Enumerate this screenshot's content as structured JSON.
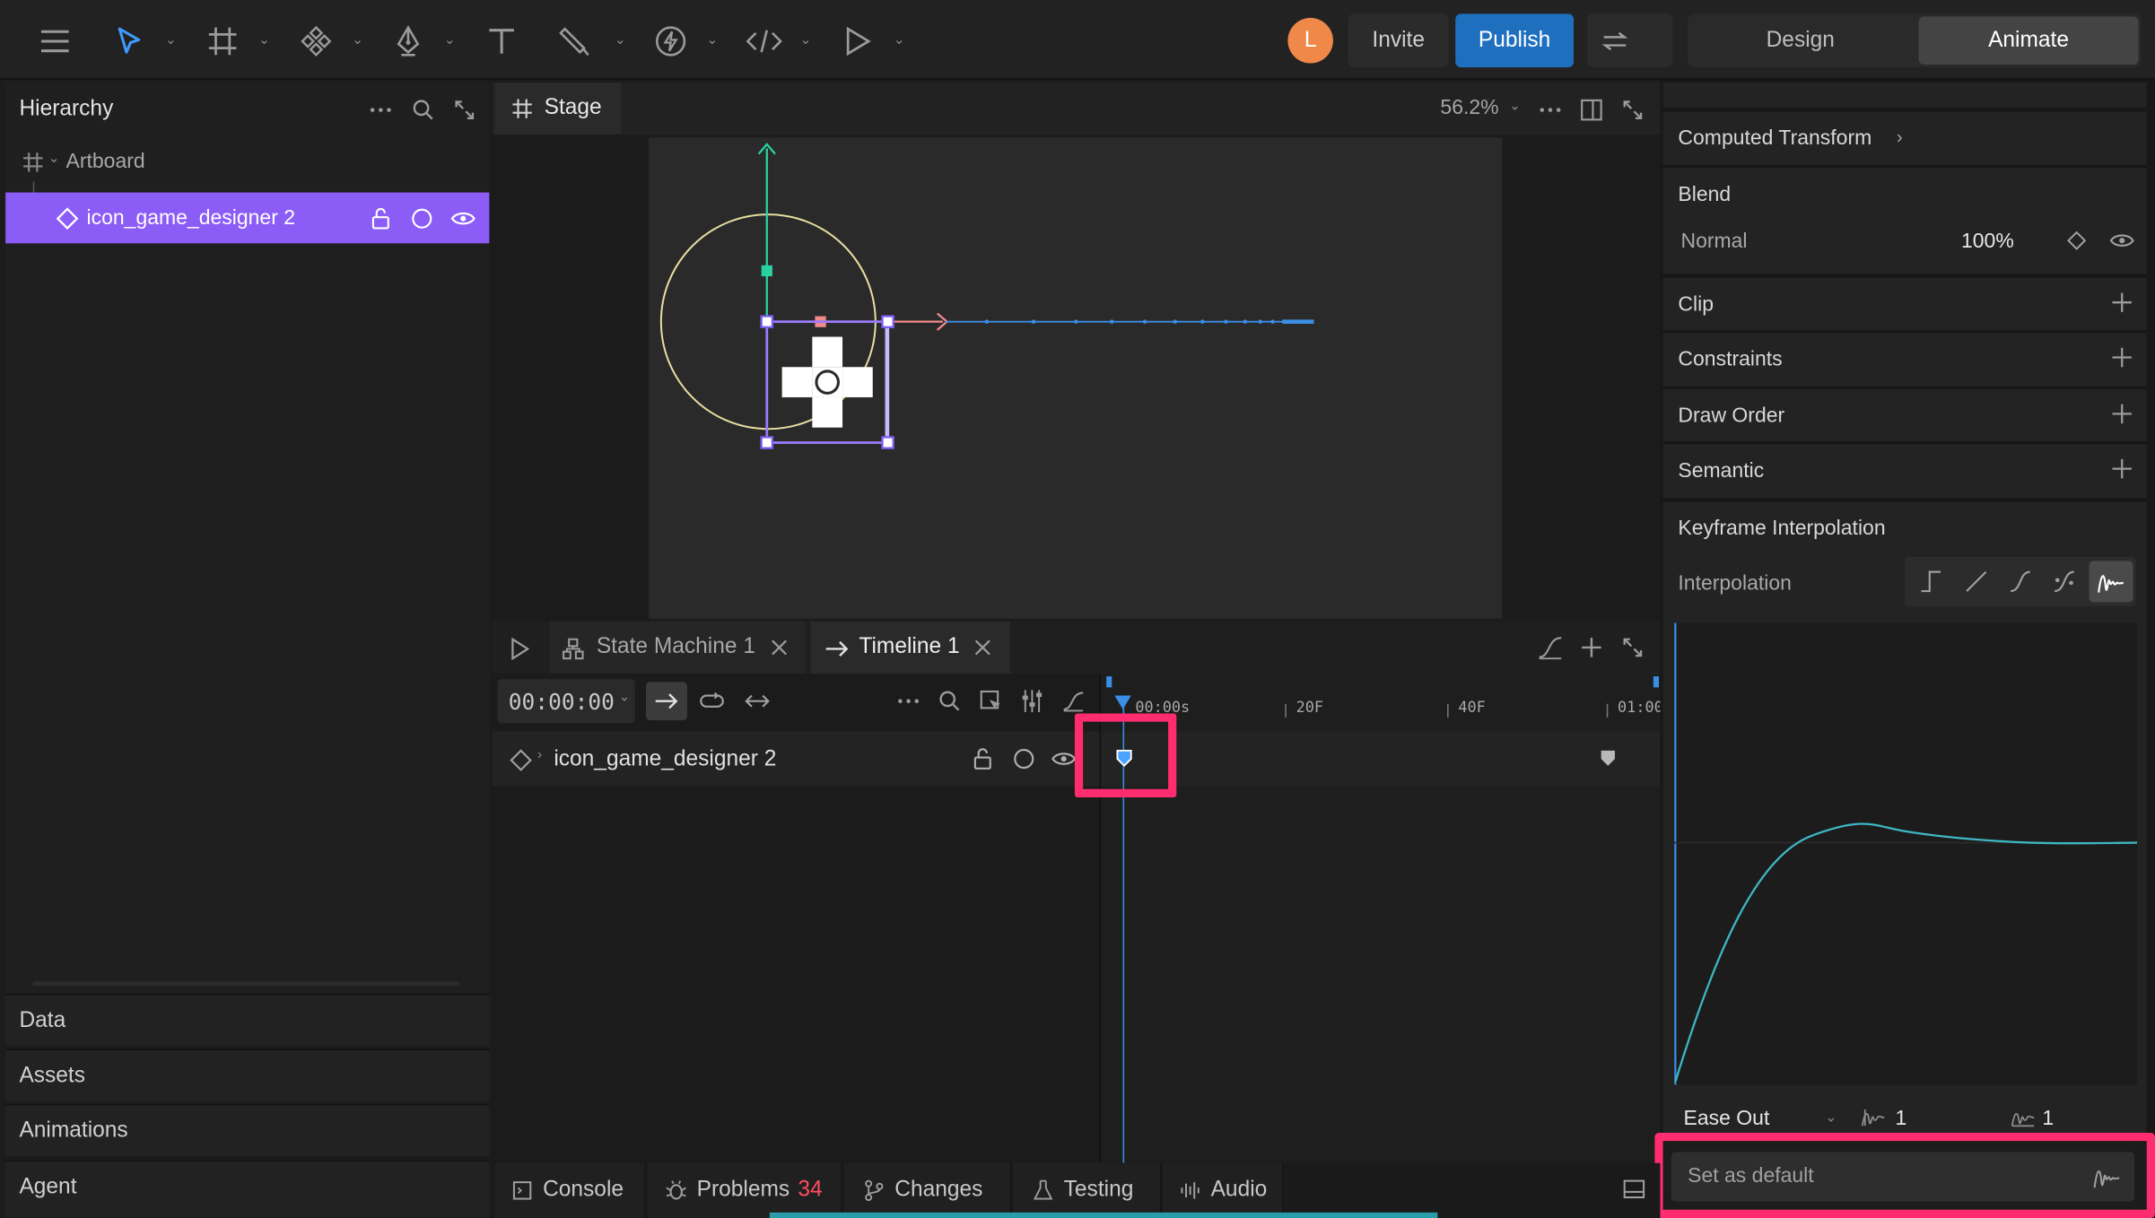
{
  "toolbar": {
    "avatar_initial": "L",
    "invite_label": "Invite",
    "publish_label": "Publish",
    "mode_design": "Design",
    "mode_animate": "Animate"
  },
  "hierarchy": {
    "title": "Hierarchy",
    "artboard_label": "Artboard",
    "selected_item": "icon_game_designer 2"
  },
  "left_sections": [
    "Data",
    "Assets",
    "Animations",
    "Agent"
  ],
  "stage": {
    "tab_label": "Stage",
    "zoom": "56.2%"
  },
  "anim_tabs": {
    "state_machine": "State Machine 1",
    "timeline": "Timeline 1"
  },
  "timeline": {
    "time": "00:00:00",
    "ruler": [
      "00:00s",
      "20F",
      "40F",
      "01:00"
    ],
    "row_label": "icon_game_designer 2"
  },
  "inspector": {
    "computed_transform": "Computed Transform",
    "blend_title": "Blend",
    "blend_mode": "Normal",
    "blend_opacity": "100%",
    "sections": [
      "Clip",
      "Constraints",
      "Draw Order",
      "Semantic"
    ],
    "keyframe_title": "Keyframe Interpolation",
    "interpolation_label": "Interpolation",
    "ease_value": "Ease Out",
    "amplitude": "1",
    "period": "1",
    "set_default": "Set as default"
  },
  "bottom_tabs": {
    "console": "Console",
    "problems": "Problems",
    "problems_count": "34",
    "changes": "Changes",
    "testing": "Testing",
    "audio": "Audio"
  },
  "colors": {
    "accent_purple": "#8b5cf6",
    "publish_blue": "#1f6fbf",
    "highlight_red": "#ff2d6f",
    "curve_teal": "#3fb6c4"
  }
}
